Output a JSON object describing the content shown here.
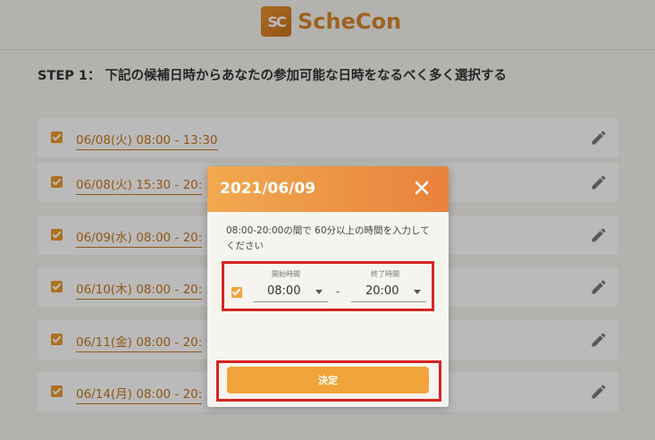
{
  "header": {
    "logo_mark": "SC",
    "logo_text": "ScheCon"
  },
  "step": {
    "title": "STEP 1： 下記の候補日時からあなたの参加可能な日時をなるべく多く選択する"
  },
  "slots": [
    {
      "label": "06/08(火) 08:00 - 13:30",
      "checked": true
    },
    {
      "label": "06/08(火) 15:30 - 20:",
      "checked": true
    },
    {
      "label": "06/09(水) 08:00 - 20:",
      "checked": true
    },
    {
      "label": "06/10(木) 08:00 - 20:",
      "checked": true
    },
    {
      "label": "06/11(金) 08:00 - 20:",
      "checked": true
    },
    {
      "label": "06/14(月) 08:00 - 20:",
      "checked": true
    }
  ],
  "modal": {
    "title": "2021/06/09",
    "instruction": "08:00-20:00の間で 60分以上の時間を入力してください",
    "start_label": "開始時間",
    "start_value": "08:00",
    "separator": "-",
    "end_label": "終了時間",
    "end_value": "20:00",
    "submit_label": "決定"
  },
  "colors": {
    "accent": "#ee9b2e",
    "highlight_border": "#d62424",
    "slot_text": "#c7781f"
  },
  "icons": {
    "close": "close-icon",
    "edit": "pencil-icon",
    "check": "checkbox-checked-icon"
  }
}
